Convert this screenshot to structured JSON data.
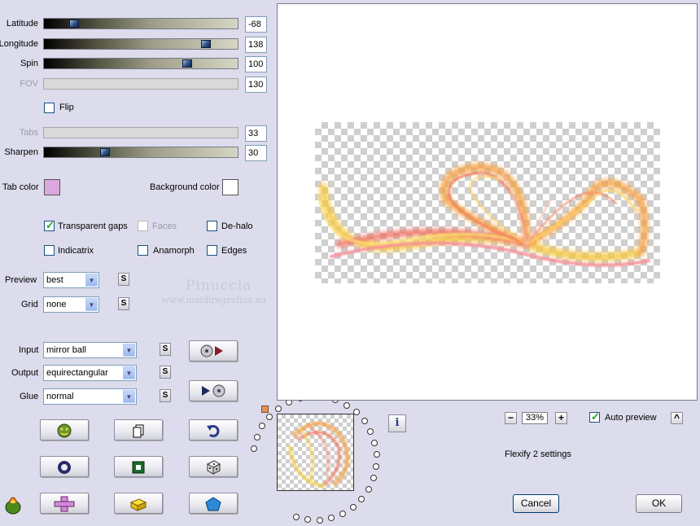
{
  "sliders": [
    {
      "label": "Latitude",
      "value": "-68",
      "fraction": 0.14,
      "enabled": true
    },
    {
      "label": "Longitude",
      "value": "138",
      "fraction": 0.86,
      "enabled": true
    },
    {
      "label": "Spin",
      "value": "100",
      "fraction": 0.76,
      "enabled": true
    },
    {
      "label": "FOV",
      "value": "130",
      "enabled": false
    },
    {
      "label": "Tabs",
      "value": "33",
      "enabled": false
    },
    {
      "label": "Sharpen",
      "value": "30",
      "fraction": 0.31,
      "enabled": true
    }
  ],
  "flip": {
    "label": "Flip",
    "checked": false
  },
  "tab_color": {
    "label": "Tab color",
    "color": "#dba7dd"
  },
  "background_color": {
    "label": "Background color",
    "color": "#ffffff"
  },
  "options": {
    "transparent_gaps": {
      "label": "Transparent gaps",
      "checked": true
    },
    "faces": {
      "label": "Faces",
      "checked": false,
      "enabled": false
    },
    "de_halo": {
      "label": "De-halo",
      "checked": false
    },
    "indicatrix": {
      "label": "Indicatrix",
      "checked": false
    },
    "anamorph": {
      "label": "Anamorph",
      "checked": false
    },
    "edges": {
      "label": "Edges",
      "checked": false
    }
  },
  "preview_select": {
    "label": "Preview",
    "value": "best"
  },
  "grid_select": {
    "label": "Grid",
    "value": "none"
  },
  "watermark": {
    "name": "Pinuccia",
    "url": "www.maidiregrafica.eu"
  },
  "input_select": {
    "label": "Input",
    "value": "mirror ball"
  },
  "output_select": {
    "label": "Output",
    "value": "equirectangular"
  },
  "glue_select": {
    "label": "Glue",
    "value": "normal"
  },
  "s_label": "S",
  "info_label": "i",
  "zoom": {
    "minus": "−",
    "value": "33%",
    "plus": "+"
  },
  "auto_preview": {
    "label": "Auto preview",
    "checked": true
  },
  "collapse_label": "^",
  "status_text": "Flexify 2 settings",
  "cancel_label": "Cancel",
  "ok_label": "OK",
  "colors": {
    "accent_blue": "#1c3c8c",
    "check_green": "#21a121",
    "panel_bg": "#dcdcec"
  }
}
